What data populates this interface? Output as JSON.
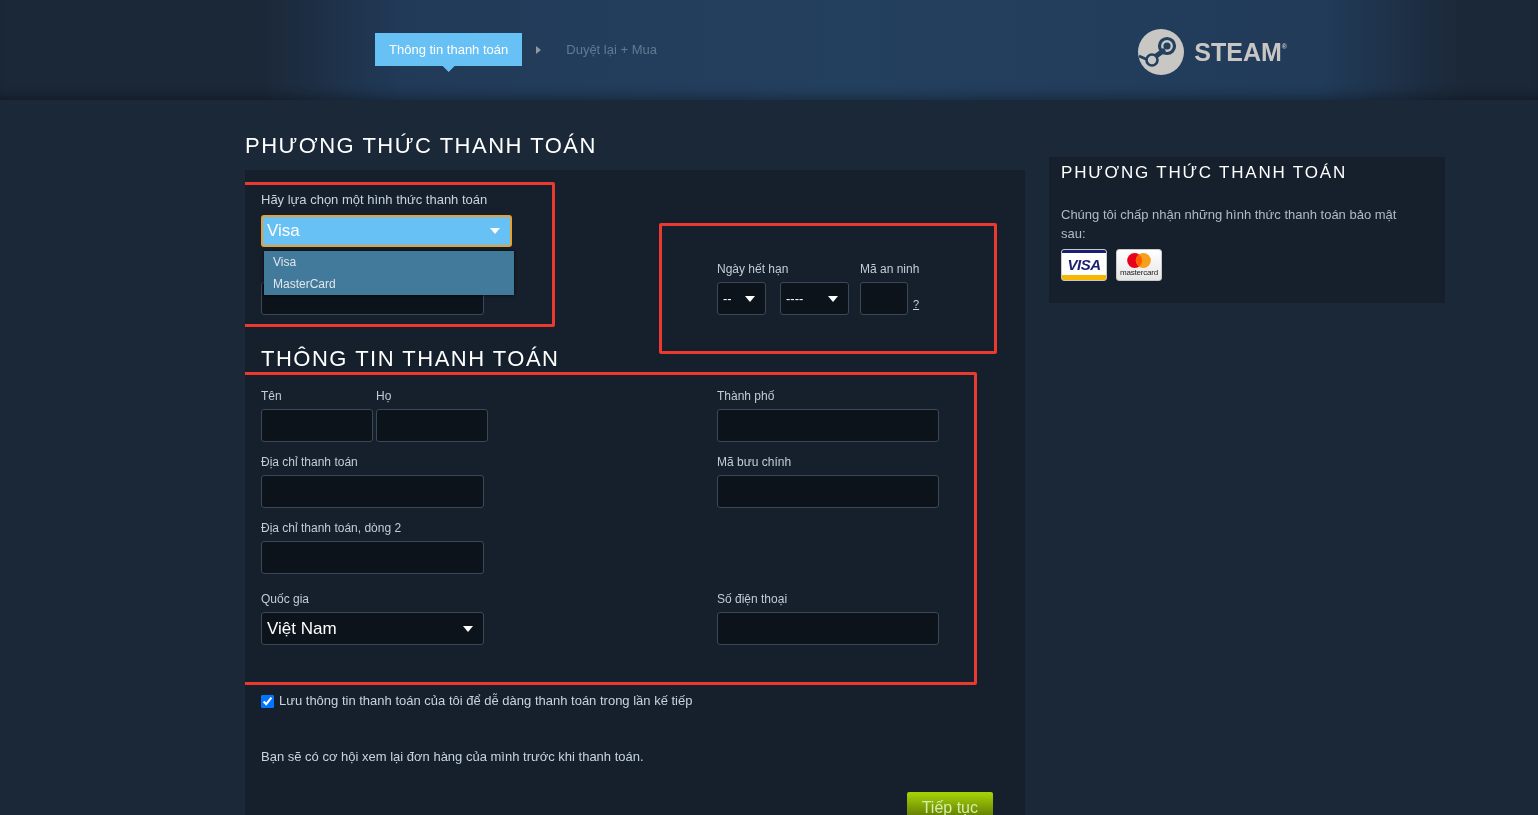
{
  "progress": {
    "steps": [
      {
        "label": "Thông tin thanh toán",
        "selected": true
      },
      {
        "label": "Duyệt lại + Mua",
        "selected": false
      }
    ]
  },
  "logo": {
    "wordmark": "STEAM$^{®}$"
  },
  "payment_method": {
    "title": "PHƯƠNG THỨC THANH TOÁN",
    "method_group": {
      "highlighted": true,
      "label": "Hãy lựa chọn một hình thức thanh toán",
      "select": {
        "value": "Visa",
        "focused": true,
        "open": true,
        "options": [
          "Visa",
          "MasterCard"
        ]
      }
    },
    "card_group": {
      "highlighted": true,
      "expiry_label": "Ngày hết hạn",
      "month": "--",
      "year": "----",
      "security_label": "Mã an ninh",
      "help_link": "?"
    }
  },
  "billing": {
    "title": "THÔNG TIN THANH TOÁN",
    "highlighted": true,
    "rows": [
      {
        "left": [
          {
            "kind": "input",
            "label": "Tên"
          },
          {
            "kind": "input",
            "label": "Họ"
          }
        ],
        "right": [
          {
            "kind": "input",
            "label": "Thành phố"
          }
        ]
      },
      {
        "left": [
          {
            "kind": "input",
            "label": "Địa chỉ thanh toán"
          }
        ],
        "right": [
          {
            "kind": "input",
            "label": "Mã bưu chính"
          }
        ]
      },
      {
        "left": [
          {
            "kind": "input",
            "label": "Địa chỉ thanh toán, dòng 2"
          }
        ]
      },
      {
        "left": [
          {
            "kind": "select",
            "label": "Quốc gia",
            "value": "Việt Nam"
          }
        ],
        "right": [
          {
            "kind": "input",
            "label": "Số điện thoại"
          }
        ]
      }
    ]
  },
  "save_info": {
    "label": "Lưu thông tin thanh toán của tôi để dễ dàng thanh toán trong lần kế tiếp",
    "checked": true
  },
  "note": "Bạn sẽ có cơ hội xem lại đơn hàng của mình trước khi thanh toán.",
  "continue_button": "Tiếp tục",
  "sidebar": {
    "title": "PHƯƠNG THỨC THANH TOÁN",
    "text": "Chúng tôi chấp nhận những hình thức thanh toán bảo mật sau:",
    "cards": [
      {
        "kind": "visa",
        "text": "VISA"
      },
      {
        "kind": "mastercard",
        "text": "mastercard"
      }
    ]
  }
}
